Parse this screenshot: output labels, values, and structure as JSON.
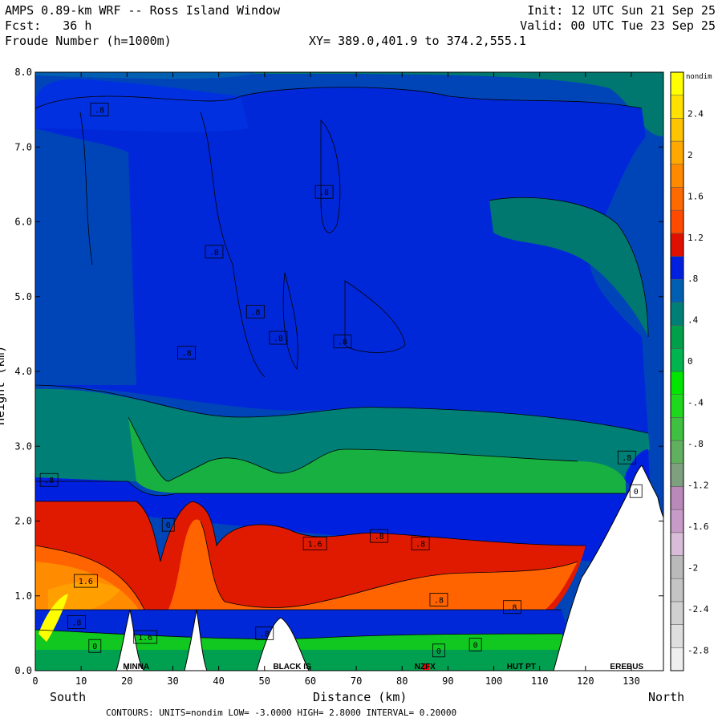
{
  "header": {
    "title": "AMPS 0.89-km WRF -- Ross Island Window",
    "init": "Init: 12 UTC Sun 21 Sep 25",
    "fcst": "Fcst:   36 h",
    "valid": "Valid: 00 UTC Tue 23 Sep 25",
    "field": "Froude Number (h=1000m)",
    "xy": "XY= 389.0,401.9 to 374.2,555.1"
  },
  "footer": {
    "south": "South",
    "north": "North",
    "contours": "CONTOURS:  UNITS=nondim  LOW= -3.0000      HIGH=  2.8000      INTERVAL=  0.20000"
  },
  "colorbar": {
    "unit": "nondim",
    "ticks": [
      "2.4",
      "2",
      "1.6",
      "1.2",
      ".8",
      ".4",
      "0",
      "-.4",
      "-.8",
      "-1.2",
      "-1.6",
      "-2",
      "-2.4",
      "-2.8"
    ],
    "colors": [
      "#eeeeee",
      "#dedede",
      "#d0d0d0",
      "#c4c4c4",
      "#bababa",
      "#d8bcd8",
      "#c79bc7",
      "#b98ab9",
      "#7fa07f",
      "#60b060",
      "#40c040",
      "#1ed81e",
      "#00e600",
      "#00b450",
      "#00a04a",
      "#007f77",
      "#005fb0",
      "#0020e0",
      "#e01000",
      "#ff4a00",
      "#ff6a00",
      "#ff8a00",
      "#ffa800",
      "#ffc400",
      "#ffe000",
      "#ffff00"
    ]
  },
  "chart_data": {
    "type": "heatmap",
    "subtype": "contour cross-section",
    "xlabel": "Distance (km)",
    "ylabel": "Height (km)",
    "xlim": [
      0,
      137
    ],
    "ylim": [
      0,
      8
    ],
    "x_ticks": [
      "0",
      "10",
      "20",
      "30",
      "40",
      "50",
      "60",
      "70",
      "80",
      "90",
      "100",
      "110",
      "120",
      "130"
    ],
    "y_ticks": [
      "0.0",
      "1.0",
      "2.0",
      "3.0",
      "4.0",
      "5.0",
      "6.0",
      "7.0",
      "8.0"
    ],
    "terrain_labels": [
      {
        "name": "MINNA",
        "x": 22
      },
      {
        "name": "BLACK IS",
        "x": 56
      },
      {
        "name": "NZFX",
        "x": 85
      },
      {
        "name": "HUT PT",
        "x": 106
      },
      {
        "name": "EREBUS",
        "x": 129
      }
    ],
    "contour_labels": [
      {
        "text": ".8",
        "x": 14,
        "y": 7.5
      },
      {
        "text": ".8",
        "x": 63,
        "y": 6.4
      },
      {
        "text": ".8",
        "x": 39,
        "y": 5.6
      },
      {
        "text": ".8",
        "x": 48,
        "y": 4.8
      },
      {
        "text": ".8",
        "x": 53,
        "y": 4.45
      },
      {
        "text": ".8",
        "x": 67,
        "y": 4.4
      },
      {
        "text": ".8",
        "x": 33,
        "y": 4.25
      },
      {
        "text": ".8",
        "x": 3,
        "y": 2.55
      },
      {
        "text": ".8",
        "x": 129,
        "y": 2.85
      },
      {
        "text": "0",
        "x": 131,
        "y": 2.4
      },
      {
        "text": "0",
        "x": 29,
        "y": 1.95
      },
      {
        "text": "1.6",
        "x": 61,
        "y": 1.7
      },
      {
        "text": ".8",
        "x": 75,
        "y": 1.8
      },
      {
        "text": ".8",
        "x": 84,
        "y": 1.7
      },
      {
        "text": "1.6",
        "x": 11,
        "y": 1.2
      },
      {
        "text": ".8",
        "x": 88,
        "y": 0.95
      },
      {
        "text": ".8",
        "x": 104,
        "y": 0.85
      },
      {
        "text": ".8",
        "x": 9,
        "y": 0.65
      },
      {
        "text": "1.6",
        "x": 24,
        "y": 0.45
      },
      {
        "text": ".8",
        "x": 50,
        "y": 0.5
      },
      {
        "text": "0",
        "x": 13,
        "y": 0.33
      },
      {
        "text": "0",
        "x": 88,
        "y": 0.27
      },
      {
        "text": "0",
        "x": 96,
        "y": 0.35
      }
    ]
  }
}
